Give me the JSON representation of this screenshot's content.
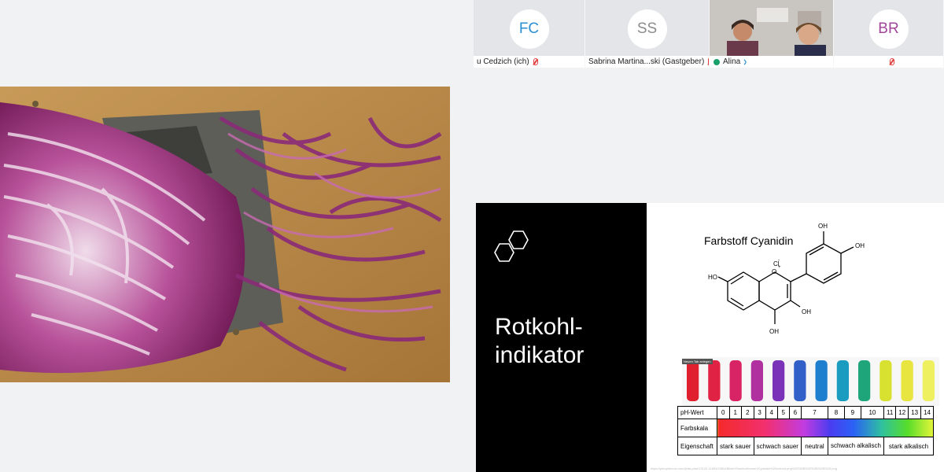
{
  "participants": [
    {
      "initials": "FC",
      "name": "u Cedzich (ich)",
      "initials_color": "#2b8fd0",
      "muted": true
    },
    {
      "initials": "SS",
      "name": "Sabrina Martina...ski (Gastgeber)",
      "initials_color": "#8c8c8c",
      "muted": true
    },
    {
      "initials": "",
      "name": "Alina",
      "muted": false,
      "video": true
    },
    {
      "initials": "BR",
      "name": "",
      "initials_color": "#a0469a",
      "muted": true
    }
  ],
  "slide": {
    "title_line1": "Rotkohl-",
    "title_line2": "indikator",
    "chem_title": "Farbstoff Cyanidin",
    "chem_labels": {
      "oh": "OH",
      "ho": "HO",
      "cl": "Cl",
      "charge": "-",
      "oplus": "O",
      "plus": "+"
    },
    "tab_label": "Neuen Tab anlegen",
    "table": {
      "row1_label": "pH-Wert",
      "ph_values": [
        "0",
        "1",
        "2",
        "3",
        "4",
        "5",
        "6",
        "7",
        "8",
        "9",
        "10",
        "11",
        "12",
        "13",
        "14"
      ],
      "row2_label": "Farbskala",
      "row3_label": "Eigenschaft",
      "properties": [
        "stark sauer",
        "schwach sauer",
        "neutral",
        "schwach alkalisch",
        "stark alkalisch"
      ]
    },
    "source": "https://pinophenolo.com/jetta-phal/13122-1189422864/Bilder/Struktur/formen/Cyanidin%20chlorid.png%20%2B%20%2B%2B%20.png"
  },
  "colors": {
    "tube_colors": [
      "#e0202e",
      "#e02244",
      "#d82464",
      "#b030a0",
      "#7a32b8",
      "#3060c8",
      "#1f7fcf",
      "#1a9cc0",
      "#1ea67a",
      "#d8e030",
      "#e8e440",
      "#eef060"
    ]
  }
}
